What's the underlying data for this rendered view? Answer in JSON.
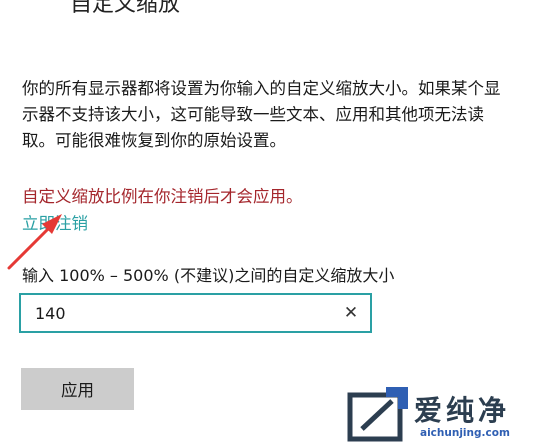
{
  "header": {
    "title": "自定义缩放"
  },
  "settings": {
    "description_lines": [
      "你的所有显示器都将设置为你输入的自定义缩放大小。如果某个显",
      "示器不支持该大小，这可能导致一些文本、应用和其他项无法读",
      "取。可能很难恢复到你的原始设置。"
    ],
    "warning": "自定义缩放比例在你注销后才会应用。",
    "signout_link": "立即注销",
    "input_label": "输入 100% – 500% (不建议)之间的自定义缩放大小",
    "scale_value": "140",
    "clear_icon": "clear-icon",
    "apply_label": "应用"
  },
  "annotation": {
    "arrow_color": "#e53935"
  },
  "watermark": {
    "brand": "爱纯净",
    "url": "aichunjing.com"
  },
  "colors": {
    "accent": "#2aa0a4",
    "warning": "#a4262c",
    "button_bg": "#cccccc"
  }
}
